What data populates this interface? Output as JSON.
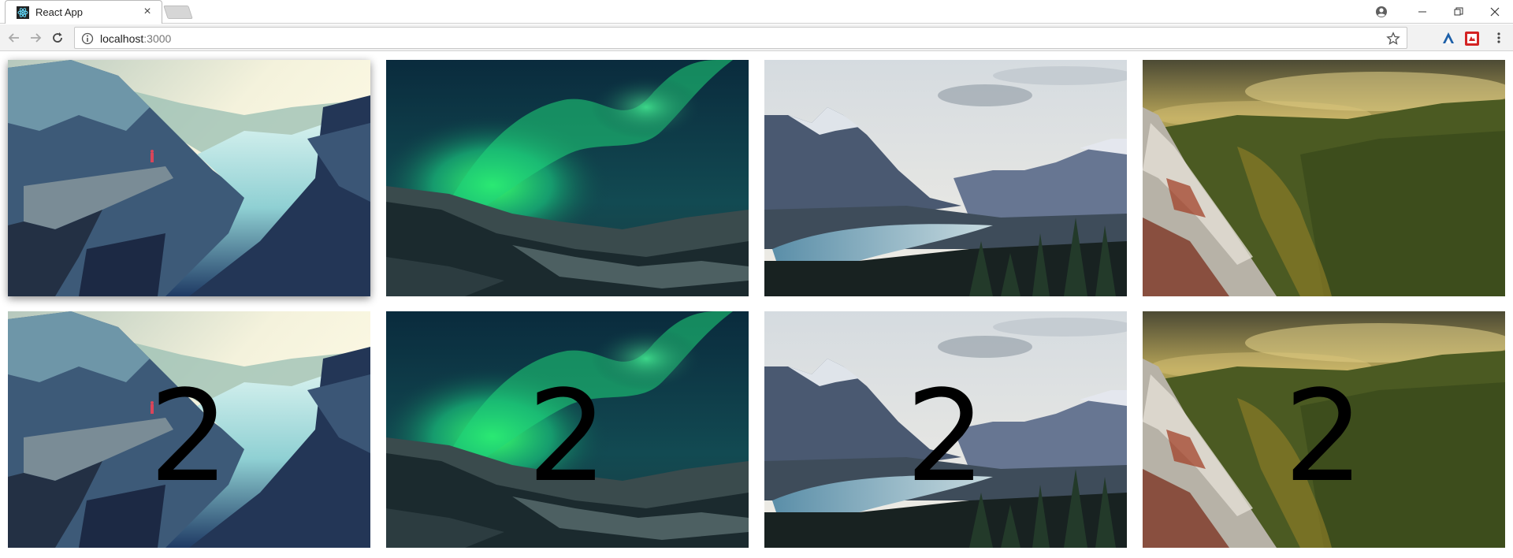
{
  "browser": {
    "tab": {
      "title": "React App",
      "favicon": "react-icon",
      "close_glyph": "×"
    },
    "address_bar": {
      "host": "localhost",
      "port": ":3000"
    },
    "icons": [
      "back-arrow-icon",
      "forward-arrow-icon",
      "reload-icon",
      "info-icon",
      "star-icon",
      "profile-icon",
      "extension-icon",
      "menu-icon"
    ],
    "window_controls": {
      "minimize": "–",
      "restore": "❐",
      "close": "✕"
    }
  },
  "gallery": {
    "row1": [
      {
        "scene": "fjord-cliff"
      },
      {
        "scene": "aurora"
      },
      {
        "scene": "mountain-lake"
      },
      {
        "scene": "autumn-valley"
      }
    ],
    "row2": [
      {
        "scene": "fjord-cliff",
        "overlay": "2"
      },
      {
        "scene": "aurora",
        "overlay": "2"
      },
      {
        "scene": "mountain-lake",
        "overlay": "2"
      },
      {
        "scene": "autumn-valley",
        "overlay": "2"
      }
    ]
  }
}
